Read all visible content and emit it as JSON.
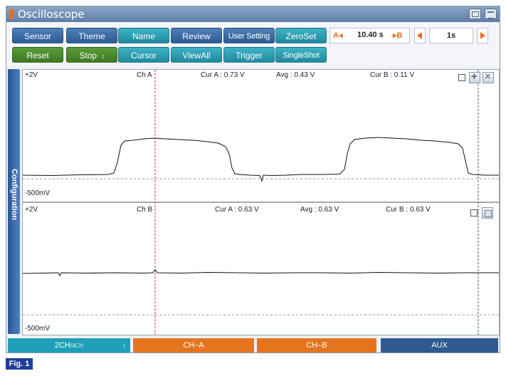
{
  "window": {
    "title": "Oscilloscope"
  },
  "toolbar": {
    "row1": [
      "Sensor",
      "Theme",
      "Name",
      "Review",
      "User Setting",
      "ZeroSet"
    ],
    "row2": [
      "Reset",
      "Stop",
      "Cursor",
      "ViewAll",
      "Trigger",
      "SingleShot"
    ],
    "stop_arrow": "↕",
    "ab_a": "A◂",
    "ab_value": "10.40 s",
    "ab_b": "▸B",
    "time_div": "1s"
  },
  "sidebar": {
    "label": "Configuration"
  },
  "plot_a": {
    "top_label": "+2V",
    "bottom_label": "-500mV",
    "channel": "Ch A",
    "cur_a": "Cur A :  0.73 V",
    "avg": "Avg : 0.43 V",
    "cur_b": "Cur B : 0.11 V"
  },
  "plot_b": {
    "top_label": "+2V",
    "bottom_label": "-500mV",
    "channel": "Ch B",
    "cur_a": "Cur A : 0.63 V",
    "avg": "Avg : 0.63 V",
    "cur_b": "Cur B : 0.63 V"
  },
  "bottom_tabs": {
    "ch_count": "2CH",
    "ch_sep": "/",
    "ch_max": "4CH",
    "ch_arrow": "↕",
    "cha": "CH–A",
    "chb": "CH–B",
    "aux": "AUX"
  },
  "figure_label": "Fig. 1",
  "colors": {
    "accent_orange": "#e4751e",
    "teal": "#1fa0b8",
    "cursor_red": "#e02020"
  }
}
